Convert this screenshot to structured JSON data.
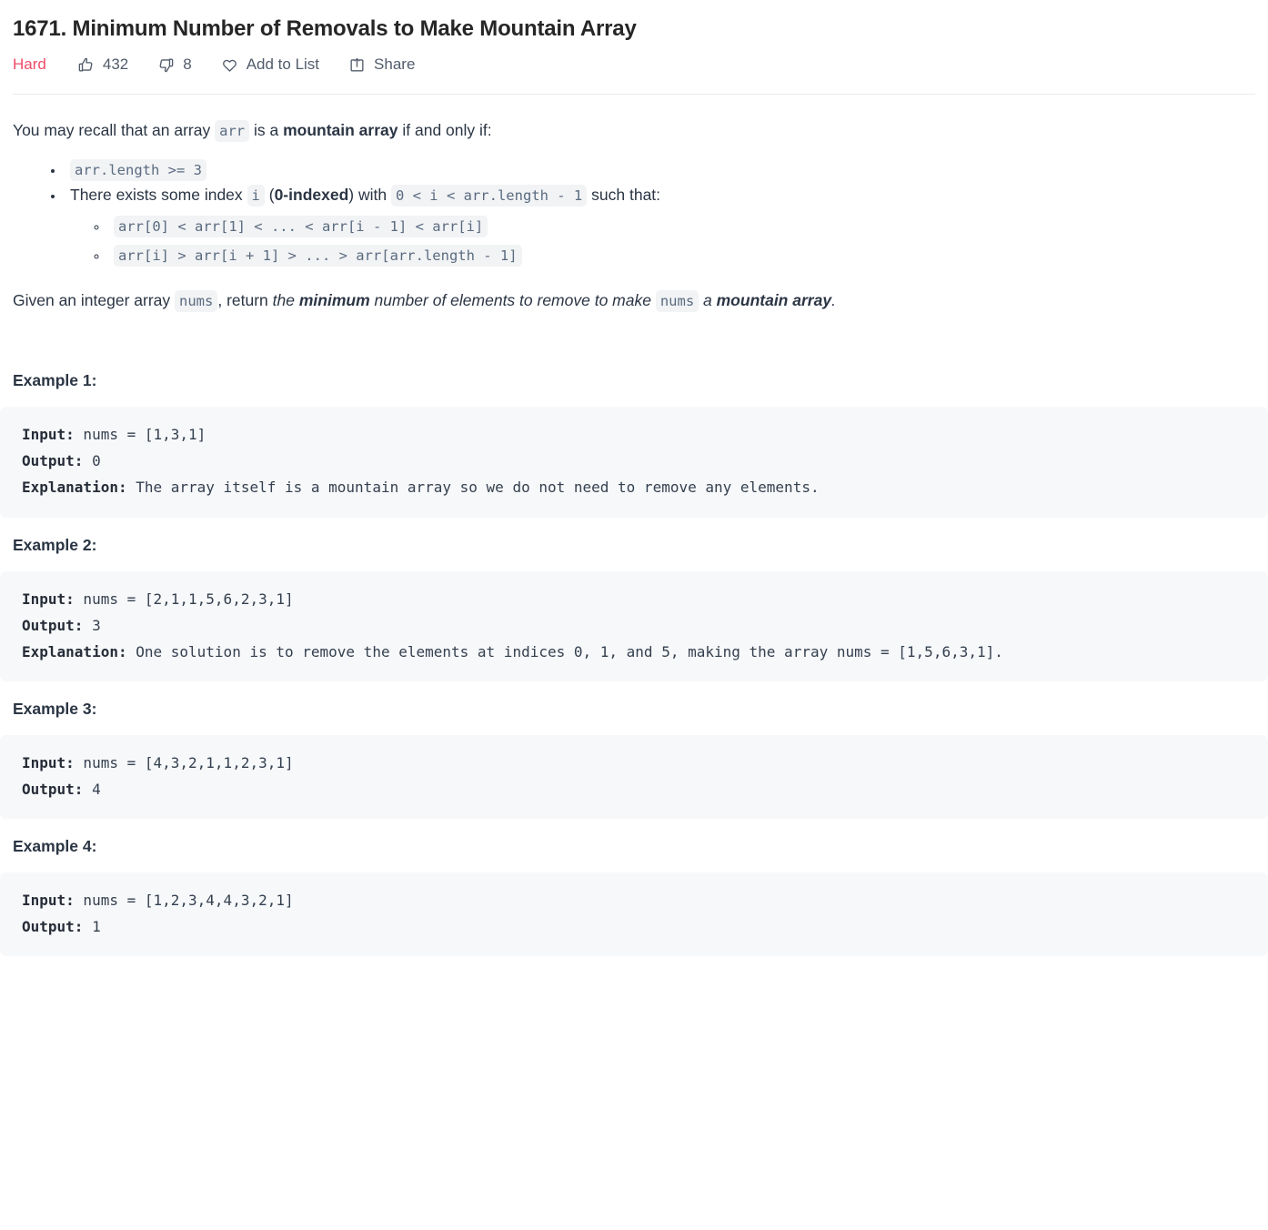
{
  "problem": {
    "title": "1671. Minimum Number of Removals to Make Mountain Array",
    "difficulty": "Hard",
    "difficulty_color": "#ef4c67"
  },
  "actions": {
    "likes": "432",
    "dislikes": "8",
    "add_to_list": "Add to List",
    "share": "Share"
  },
  "description": {
    "intro_1": "You may recall that an array ",
    "intro_code": "arr",
    "intro_2": " is a ",
    "intro_bold": "mountain array",
    "intro_3": " if and only if:",
    "bullet_1_code": "arr.length >= 3",
    "bullet_2_a": "There exists some index ",
    "bullet_2_code_i": "i",
    "bullet_2_b": " (",
    "bullet_2_bold": "0-indexed",
    "bullet_2_c": ") with ",
    "bullet_2_code_range": "0 < i < arr.length - 1",
    "bullet_2_d": " such that:",
    "sub_bullet_1": "arr[0] < arr[1] < ... < arr[i - 1] < arr[i]",
    "sub_bullet_2": "arr[i] > arr[i + 1] > ... > arr[arr.length - 1]",
    "task_1": "Given an integer array ",
    "task_code_1": "nums",
    "task_2": ", return ",
    "task_italic_1": "the ",
    "task_italic_bold_1": "minimum",
    "task_italic_2": " number of elements to remove to make ",
    "task_code_2": "nums",
    "task_italic_3": " a ",
    "task_italic_bold_2": "mountain array",
    "task_period": "."
  },
  "examples": [
    {
      "heading": "Example 1:",
      "input_label": "Input:",
      "input_value": " nums = [1,3,1]",
      "output_label": "Output:",
      "output_value": " 0",
      "explanation_label": "Explanation:",
      "explanation_value": " The array itself is a mountain array so we do not need to remove any elements."
    },
    {
      "heading": "Example 2:",
      "input_label": "Input:",
      "input_value": " nums = [2,1,1,5,6,2,3,1]",
      "output_label": "Output:",
      "output_value": " 3",
      "explanation_label": "Explanation:",
      "explanation_value": " One solution is to remove the elements at indices 0, 1, and 5, making the array nums = [1,5,6,3,1]."
    },
    {
      "heading": "Example 3:",
      "input_label": "Input:",
      "input_value": " nums = [4,3,2,1,1,2,3,1]",
      "output_label": "Output:",
      "output_value": " 4",
      "explanation_label": "",
      "explanation_value": ""
    },
    {
      "heading": "Example 4:",
      "input_label": "Input:",
      "input_value": " nums = [1,2,3,4,4,3,2,1]",
      "output_label": "Output:",
      "output_value": " 1",
      "explanation_label": "",
      "explanation_value": ""
    }
  ]
}
